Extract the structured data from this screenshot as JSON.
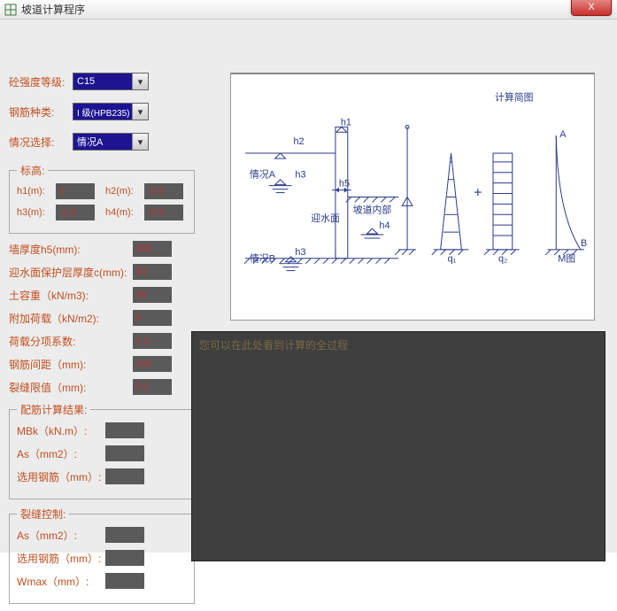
{
  "window": {
    "title": "坡道计算程序",
    "close_icon": "X"
  },
  "controls": {
    "concrete_label": "砼强度等级:",
    "concrete_value": "C15",
    "rebar_label": "钢筋种类:",
    "rebar_value": "I 级(HPB235)",
    "case_label": "情况选择:",
    "case_value": "情况A"
  },
  "elev_group": {
    "legend": "标高:",
    "h1_label": "h1(m):",
    "h1_value": "0",
    "h2_label": "h2(m):",
    "h2_value": "-0.5",
    "h3_label": "h3(m):",
    "h3_value": "-1.0",
    "h4_label": "h4(m):",
    "h4_value": "-4.5"
  },
  "params": {
    "wall_thick_label": "墙厚度h5(mm):",
    "wall_thick_value": "350",
    "cover_label": "迎水面保护层厚度c(mm):",
    "cover_value": "50",
    "soil_label": "土容重（kN/m3):",
    "soil_value": "18",
    "addl_label": "附加荷载（kN/m2):",
    "addl_value": "0",
    "factor_label": "荷载分项系数:",
    "factor_value": "1.2",
    "spacing_label": "钢筋间距（mm):",
    "spacing_value": "100",
    "crack_label": "裂缝限值（mm):",
    "crack_value": "0.2"
  },
  "results_group": {
    "legend": "配筋计算结果:",
    "mbk_label": "MBk（kN.m）:",
    "as_label": "As（mm2）:",
    "bar_label": "选用钢筋（mm）:"
  },
  "crack_group": {
    "legend": "裂缝控制:",
    "as_label": "As（mm2）:",
    "bar_label": "选用钢筋（mm）:",
    "wmax_label": "Wmax（mm）:"
  },
  "diagram": {
    "title": "计算简图",
    "h1": "h1",
    "h2": "h2",
    "h3": "h3",
    "h5": "h5",
    "h4": "h4",
    "caseA": "情况A",
    "caseB": "情况B",
    "water_side": "迎水面",
    "ramp_side": "坡道内部",
    "q1": "q₁",
    "q2": "q₂",
    "A": "A",
    "B": "B",
    "M": "M图"
  },
  "output_text": "您可以在此处看到计算的全过程"
}
